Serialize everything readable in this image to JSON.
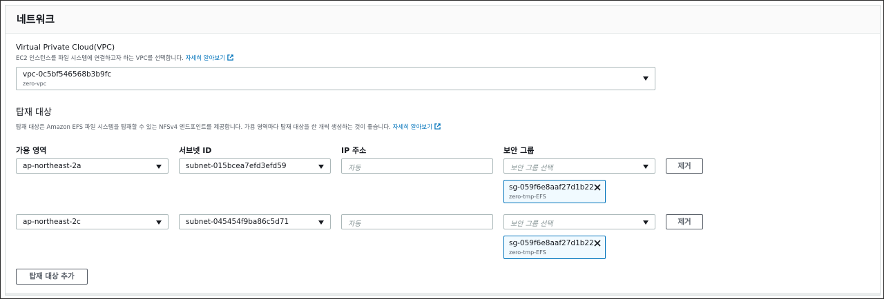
{
  "header": {
    "title": "네트워크"
  },
  "vpc": {
    "label": "Virtual Private Cloud(VPC)",
    "description": "EC2 인스턴스를 파일 시스템에 연결하고자 하는 VPC를 선택합니다.",
    "learn_more": "자세히 알아보기",
    "selected_id": "vpc-0c5bf546568b3b9fc",
    "selected_name": "zero-vpc"
  },
  "mount_targets": {
    "title": "탑재 대상",
    "description": "탑재 대상은 Amazon EFS 파일 시스템을 탑재할 수 있는 NFSv4 엔드포인트를 제공합니다. 가용 영역마다 탑재 대상을 한 개씩 생성하는 것이 좋습니다.",
    "learn_more": "자세히 알아보기",
    "columns": {
      "az": "가용 영역",
      "subnet": "서브넷 ID",
      "ip": "IP 주소",
      "sg": "보안 그룹"
    },
    "rows": [
      {
        "az": "ap-northeast-2a",
        "subnet": "subnet-015bcea7efd3efd59",
        "ip_placeholder": "자동",
        "sg_placeholder": "보안 그룹 선택",
        "remove_label": "제거",
        "token": {
          "id": "sg-059f6e8aaf27d1b22",
          "name": "zero-tmp-EFS"
        }
      },
      {
        "az": "ap-northeast-2c",
        "subnet": "subnet-045454f9ba86c5d71",
        "ip_placeholder": "자동",
        "sg_placeholder": "보안 그룹 선택",
        "remove_label": "제거",
        "token": {
          "id": "sg-059f6e8aaf27d1b22",
          "name": "zero-tmp-EFS"
        }
      }
    ],
    "add_button": "탑재 대상 추가"
  },
  "icons": {
    "external_link": "external-link-icon",
    "dropdown": "caret-down-icon",
    "dismiss": "close-icon"
  },
  "colors": {
    "link": "#0073bb",
    "token_border": "#0073bb",
    "token_bg": "#f1faff",
    "border": "#aab7b8"
  }
}
